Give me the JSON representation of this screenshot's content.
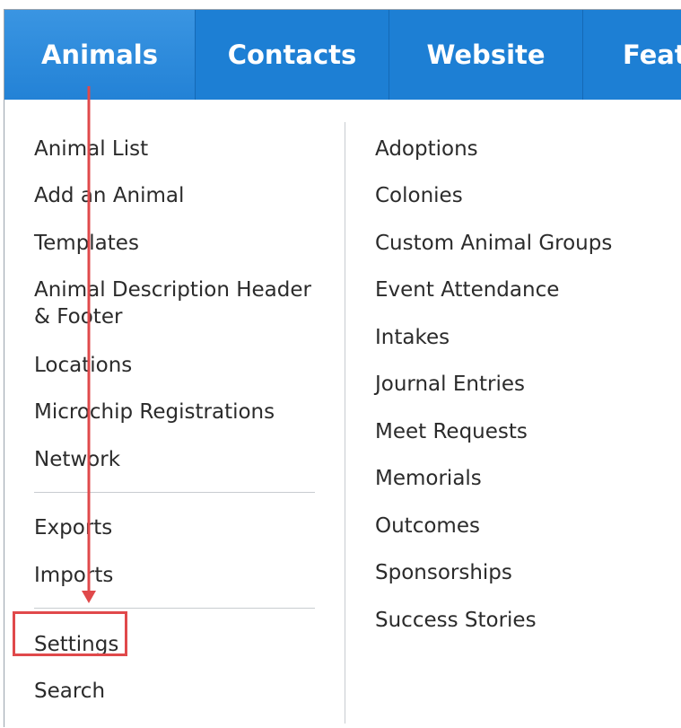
{
  "nav": {
    "tabs": [
      {
        "label": "Animals"
      },
      {
        "label": "Contacts"
      },
      {
        "label": "Website"
      },
      {
        "label": "Feat"
      }
    ]
  },
  "menu": {
    "left": [
      "Animal List",
      "Add an Animal",
      "Templates",
      "Animal Description Header & Footer",
      "Locations",
      "Microchip Registrations",
      "Network",
      "Exports",
      "Imports",
      "Settings",
      "Search"
    ],
    "right": [
      "Adoptions",
      "Colonies",
      "Custom Animal Groups",
      "Event Attendance",
      "Intakes",
      "Journal Entries",
      "Meet Requests",
      "Memorials",
      "Outcomes",
      "Sponsorships",
      "Success Stories"
    ]
  },
  "annotation": {
    "arrow_color": "#e0494b",
    "highlight_color": "#e0494b",
    "highlight_target": "Settings"
  }
}
